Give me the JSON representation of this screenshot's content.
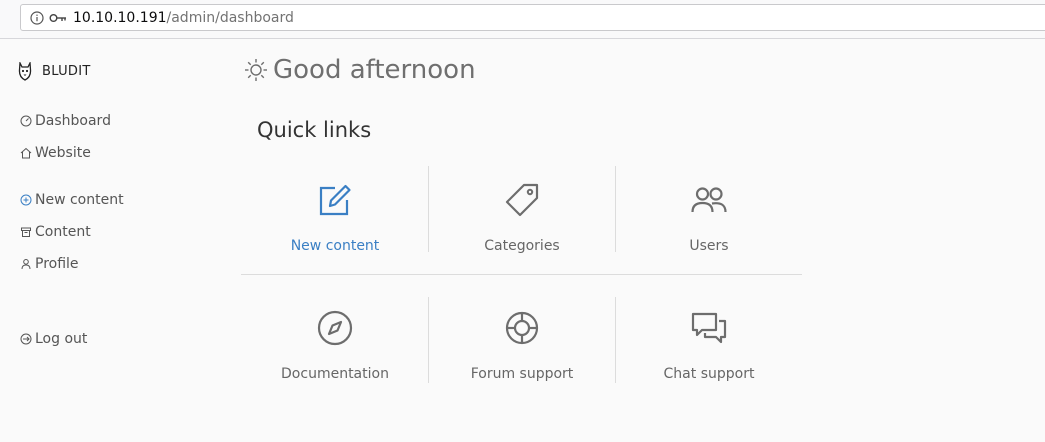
{
  "browser": {
    "url_host": "10.10.10.191",
    "url_path": "/admin/dashboard"
  },
  "brand": {
    "name": "BLUDIT"
  },
  "sidebar": {
    "items": [
      {
        "label": "Dashboard",
        "icon": "dashboard-icon"
      },
      {
        "label": "Website",
        "icon": "home-icon"
      },
      {
        "label": "New content",
        "icon": "plus-circle-icon"
      },
      {
        "label": "Content",
        "icon": "archive-icon"
      },
      {
        "label": "Profile",
        "icon": "person-icon"
      },
      {
        "label": "Log out",
        "icon": "logout-icon"
      }
    ]
  },
  "main": {
    "greeting": "Good afternoon",
    "greeting_icon": "sun-icon",
    "quick_links_title": "Quick links",
    "tiles": [
      {
        "label": "New content",
        "icon": "edit-icon"
      },
      {
        "label": "Categories",
        "icon": "tag-icon"
      },
      {
        "label": "Users",
        "icon": "users-icon"
      },
      {
        "label": "Documentation",
        "icon": "compass-icon"
      },
      {
        "label": "Forum support",
        "icon": "lifebuoy-icon"
      },
      {
        "label": "Chat support",
        "icon": "chat-icon"
      }
    ]
  },
  "colors": {
    "accent": "#3a7fc4",
    "icon_gray": "#6d6d6d",
    "background": "#fafafa"
  }
}
